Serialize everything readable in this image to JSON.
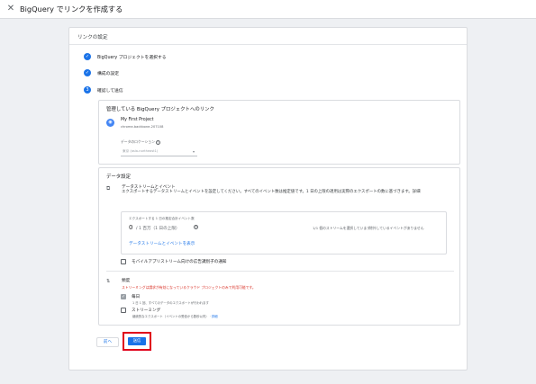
{
  "header": {
    "close_icon": "close-icon",
    "title": "BigQuery でリンクを作成する"
  },
  "sheet": {
    "title": "リンクの設定"
  },
  "steps": [
    {
      "label": "BigQuery プロジェクトを選択する",
      "icon": "check-icon",
      "icon_char": "✓"
    },
    {
      "label": "構成の設定",
      "icon": "check-icon",
      "icon_char": "✓"
    },
    {
      "label": "確認して送信",
      "icon": "step-number-icon",
      "icon_char": "3"
    }
  ],
  "project_card": {
    "title": "管理している BigQuery プロジェクトへのリンク",
    "project_name": "My First Project",
    "project_id": "chrome-backbone-207108",
    "location_label": "データのロケーション",
    "location_value": "東京 (asia-northeast1)"
  },
  "data_settings": {
    "title": "データ設定",
    "stream_title": "データストリームとイベント",
    "stream_desc": "エクスポートするデータストリームとイベントを設定してください。すべてのイベント数は推定値です。1 日の上限の適用は実際のエクスポートの数に基づきます。詳細",
    "inner": {
      "label": "エクスポートする 1 日の推定合計イベント数",
      "big_value": "0",
      "big_sub": "/ 1 百万（1 日の上限）",
      "streams_text": "1/1 個のストリームを選択しています",
      "events_text": "除外しているイベントがありません",
      "link": "データストリームとイベントを表示"
    },
    "mobile_ads_label": "モバイルアプリストリーム向けの広告識別子の通知",
    "frequency_title": "頻度",
    "frequency_warning": "ストリーミングは請求が有効になっているクラウド プロジェクトのみで利用可能です。",
    "daily_label": "毎日",
    "daily_sub": "1 日 1 回、すべてのデータのエクスポートが行われます",
    "streaming_label": "ストリーミング",
    "streaming_sub": "継続的なエクスポート（イベントの受信から数秒以内）",
    "streaming_link": "詳細"
  },
  "footer": {
    "back_label": "前へ",
    "send_label": "送信"
  },
  "colors": {
    "accent": "#1a73e8",
    "highlight": "#e0001a",
    "warning": "#d93025"
  }
}
